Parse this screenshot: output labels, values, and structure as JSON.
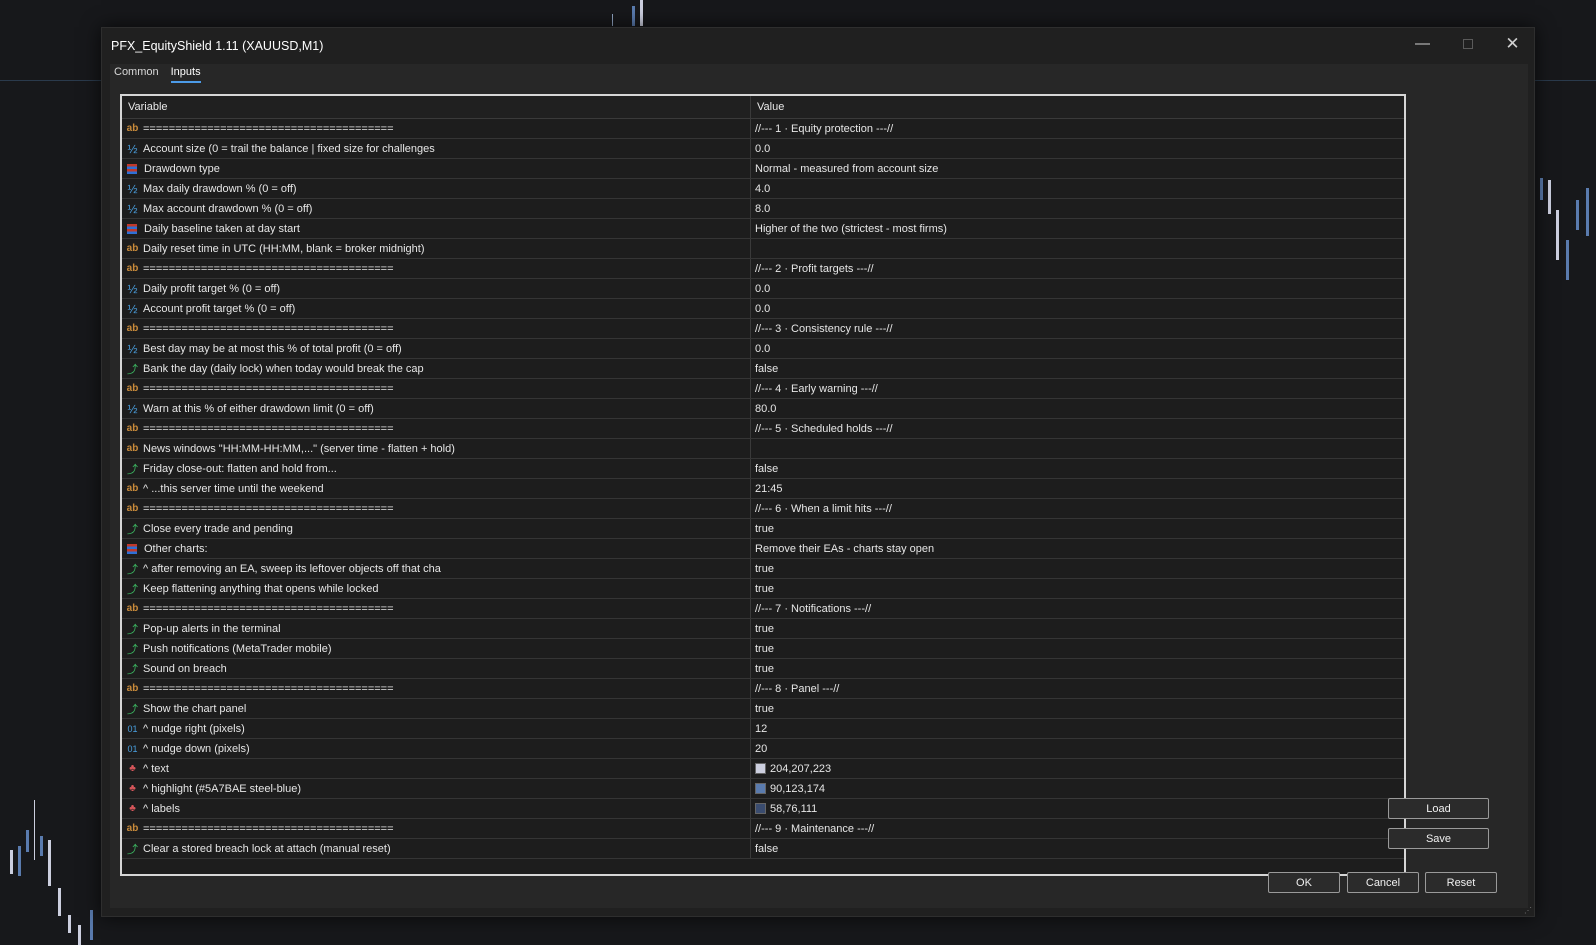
{
  "window": {
    "title": "PFX_EquityShield 1.11 (XAUUSD,M1)"
  },
  "tabs": [
    {
      "label": "Common"
    },
    {
      "label": "Inputs"
    }
  ],
  "table": {
    "headers": {
      "variable": "Variable",
      "value": "Value"
    },
    "rows": [
      {
        "icon": "ab",
        "variable": "=======================================",
        "value": "//--- 1 · Equity protection ---//"
      },
      {
        "icon": "dbl",
        "variable": "Account size (0 = trail the balance | fixed size for challenges",
        "value": "0.0"
      },
      {
        "icon": "enum",
        "variable": "Drawdown type",
        "value": "Normal - measured from account size"
      },
      {
        "icon": "dbl",
        "variable": "Max daily drawdown % (0 = off)",
        "value": "4.0"
      },
      {
        "icon": "dbl",
        "variable": "Max account drawdown % (0 = off)",
        "value": "8.0"
      },
      {
        "icon": "enum",
        "variable": "Daily baseline taken at day start",
        "value": "Higher of the two (strictest - most firms)"
      },
      {
        "icon": "ab",
        "variable": "Daily reset time in UTC (HH:MM, blank = broker midnight)",
        "value": ""
      },
      {
        "icon": "ab",
        "variable": "=======================================",
        "value": "//--- 2 · Profit targets ---//"
      },
      {
        "icon": "dbl",
        "variable": "Daily profit target % (0 = off)",
        "value": "0.0"
      },
      {
        "icon": "dbl",
        "variable": "Account profit target % (0 = off)",
        "value": "0.0"
      },
      {
        "icon": "ab",
        "variable": "=======================================",
        "value": "//--- 3 · Consistency rule ---//"
      },
      {
        "icon": "dbl",
        "variable": "Best day may be at most this % of total profit (0 = off)",
        "value": "0.0"
      },
      {
        "icon": "bool",
        "variable": "Bank the day (daily lock) when today would break the cap",
        "value": "false"
      },
      {
        "icon": "ab",
        "variable": "=======================================",
        "value": "//--- 4 · Early warning ---//"
      },
      {
        "icon": "dbl",
        "variable": "Warn at this % of either drawdown limit (0 = off)",
        "value": "80.0"
      },
      {
        "icon": "ab",
        "variable": "=======================================",
        "value": "//--- 5 · Scheduled holds ---//"
      },
      {
        "icon": "ab",
        "variable": "News windows \"HH:MM-HH:MM,...\" (server time - flatten + hold)",
        "value": ""
      },
      {
        "icon": "bool",
        "variable": "Friday close-out: flatten and hold from...",
        "value": "false"
      },
      {
        "icon": "ab",
        "variable": "^ ...this server time until the weekend",
        "value": "21:45"
      },
      {
        "icon": "ab",
        "variable": "=======================================",
        "value": "//--- 6 · When a limit hits ---//"
      },
      {
        "icon": "bool",
        "variable": "Close every trade and pending",
        "value": "true"
      },
      {
        "icon": "enum",
        "variable": "Other charts:",
        "value": "Remove their EAs - charts stay open"
      },
      {
        "icon": "bool",
        "variable": "^ after removing an EA, sweep its leftover objects off that cha",
        "value": "true"
      },
      {
        "icon": "bool",
        "variable": "Keep flattening anything that opens while locked",
        "value": "true"
      },
      {
        "icon": "ab",
        "variable": "=======================================",
        "value": "//--- 7 · Notifications ---//"
      },
      {
        "icon": "bool",
        "variable": "Pop-up alerts in the terminal",
        "value": "true"
      },
      {
        "icon": "bool",
        "variable": "Push notifications (MetaTrader mobile)",
        "value": "true"
      },
      {
        "icon": "bool",
        "variable": "Sound on breach",
        "value": "true"
      },
      {
        "icon": "ab",
        "variable": "=======================================",
        "value": "//--- 8 · Panel ---//"
      },
      {
        "icon": "bool",
        "variable": "Show the chart panel",
        "value": "true"
      },
      {
        "icon": "int",
        "variable": "^ nudge right (pixels)",
        "value": "12"
      },
      {
        "icon": "int",
        "variable": "^ nudge down (pixels)",
        "value": "20"
      },
      {
        "icon": "clr",
        "variable": "^ text",
        "value": "204,207,223",
        "swatch": "#CCCFDF"
      },
      {
        "icon": "clr",
        "variable": "^ highlight (#5A7BAE steel-blue)",
        "value": "90,123,174",
        "swatch": "#5A7BAE"
      },
      {
        "icon": "clr",
        "variable": "^ labels",
        "value": "58,76,111",
        "swatch": "#3A4C6F"
      },
      {
        "icon": "ab",
        "variable": "=======================================",
        "value": "//--- 9 · Maintenance ---//"
      },
      {
        "icon": "bool",
        "variable": "Clear a stored breach lock at attach (manual reset)",
        "value": "false"
      }
    ]
  },
  "icons": {
    "ab": "ab",
    "dbl": "½",
    "bool": "⤴",
    "int": "01",
    "clr": "♣",
    "minimize": "—",
    "close": "✕"
  },
  "buttons": {
    "load": "Load",
    "save": "Save",
    "ok": "OK",
    "cancel": "Cancel",
    "reset": "Reset"
  }
}
